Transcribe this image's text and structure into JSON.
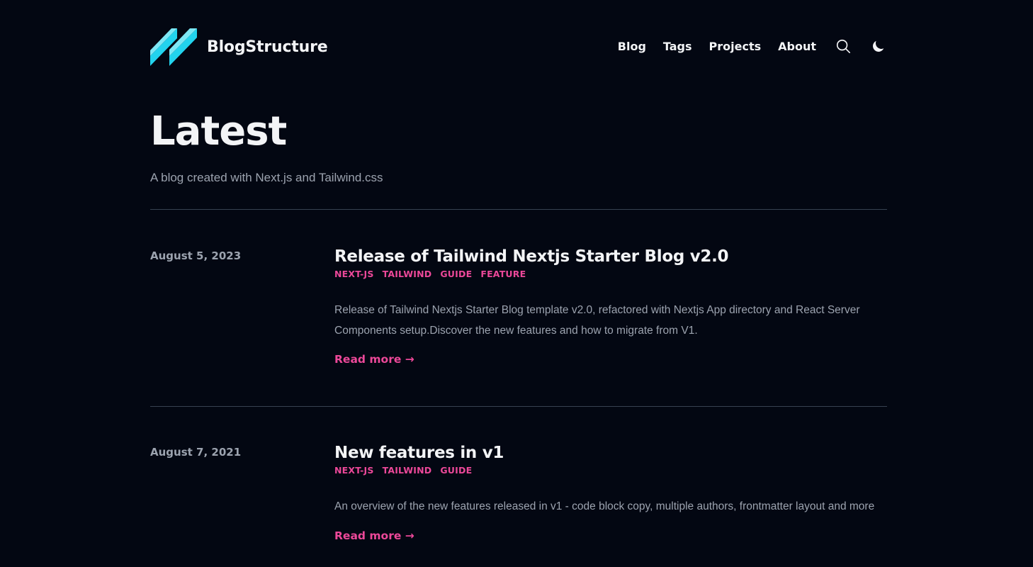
{
  "header": {
    "brand": "BlogStructure",
    "nav": [
      "Blog",
      "Tags",
      "Projects",
      "About"
    ]
  },
  "hero": {
    "title": "Latest",
    "subtitle": "A blog created with Next.js and Tailwind.css"
  },
  "posts": [
    {
      "date": "August 5, 2023",
      "title": "Release of Tailwind Nextjs Starter Blog v2.0",
      "tags": [
        "NEXT-JS",
        "TAILWIND",
        "GUIDE",
        "FEATURE"
      ],
      "summary": "Release of Tailwind Nextjs Starter Blog template v2.0, refactored with Nextjs App directory and React Server Components setup.Discover the new features and how to migrate from V1.",
      "read_more": "Read more →"
    },
    {
      "date": "August 7, 2021",
      "title": "New features in v1",
      "tags": [
        "NEXT-JS",
        "TAILWIND",
        "GUIDE"
      ],
      "summary": "An overview of the new features released in v1 - code block copy, multiple authors, frontmatter layout and more",
      "read_more": "Read more →"
    }
  ],
  "icons": {
    "logo": "logo-icon",
    "search": "search-icon",
    "theme": "moon-icon"
  },
  "colors": {
    "background": "#030712",
    "text": "#f3f4f6",
    "muted": "#9ca3af",
    "accent": "#ec4899",
    "logo": "#22d3ee",
    "divider": "#374151"
  }
}
